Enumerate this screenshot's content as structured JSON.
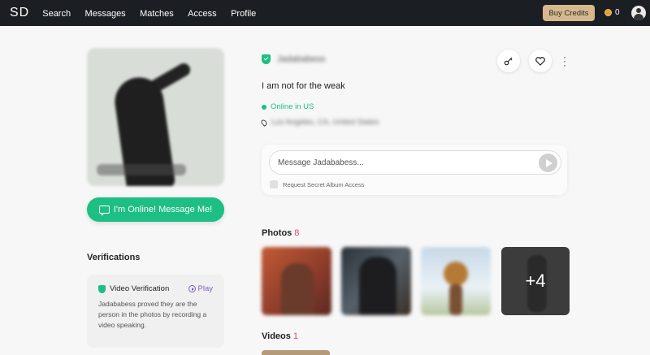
{
  "nav": {
    "logo": "SD",
    "items": [
      "Search",
      "Messages",
      "Matches",
      "Access",
      "Profile"
    ],
    "buy_credits": "Buy Credits",
    "credits": "0"
  },
  "profile": {
    "name": "Jadababess",
    "tagline": "I am not for the weak",
    "status": "Online in US",
    "location": "Los Angeles, CA, United States",
    "cta": "I'm Online! Message Me!"
  },
  "message": {
    "placeholder": "Message Jadababess...",
    "request_label": "Request Secret Album Access"
  },
  "verifications": {
    "title": "Verifications",
    "item_title": "Video Verification",
    "play": "Play",
    "description": "Jadababess proved they are the person in the photos by recording a video speaking."
  },
  "photos": {
    "title": "Photos",
    "count": "8",
    "more": "+4"
  },
  "videos": {
    "title": "Videos",
    "count": "1"
  },
  "colors": {
    "accent_green": "#1dbf84",
    "count_pink": "#e0447a",
    "buy_gold": "#d5b98c",
    "topbar": "#1b1e23"
  }
}
